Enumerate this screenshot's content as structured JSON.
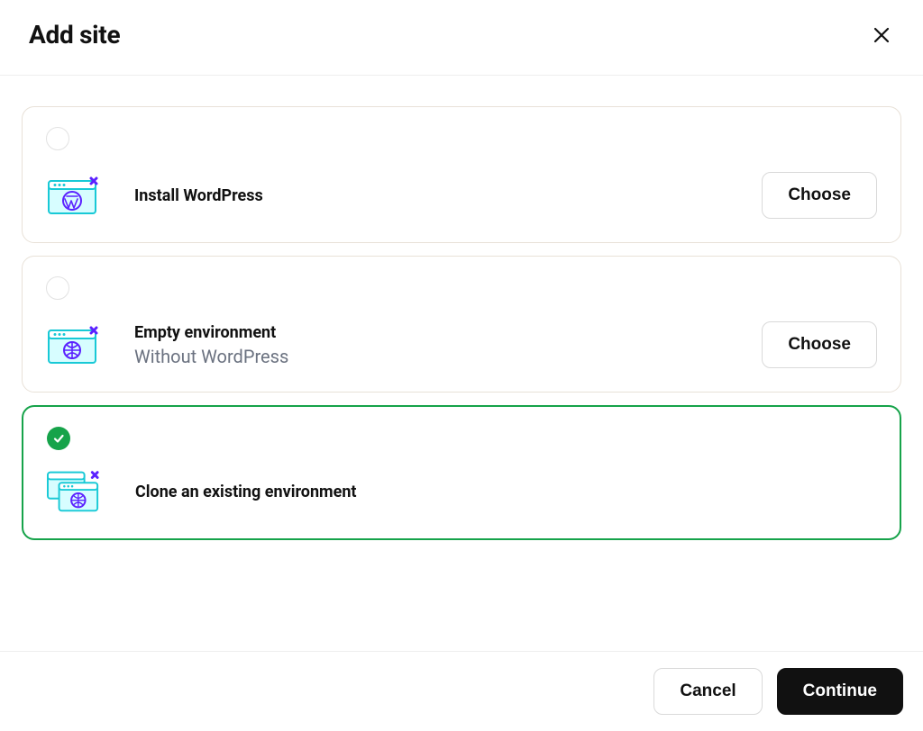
{
  "header": {
    "title": "Add site"
  },
  "options": [
    {
      "title": "Install WordPress",
      "subtitle": "",
      "choose_label": "Choose",
      "selected": false,
      "icon": "wordpress"
    },
    {
      "title": "Empty environment",
      "subtitle": "Without WordPress",
      "choose_label": "Choose",
      "selected": false,
      "icon": "globe"
    },
    {
      "title": "Clone an existing environment",
      "subtitle": "",
      "choose_label": "",
      "selected": true,
      "icon": "clone"
    }
  ],
  "footer": {
    "cancel_label": "Cancel",
    "continue_label": "Continue"
  }
}
